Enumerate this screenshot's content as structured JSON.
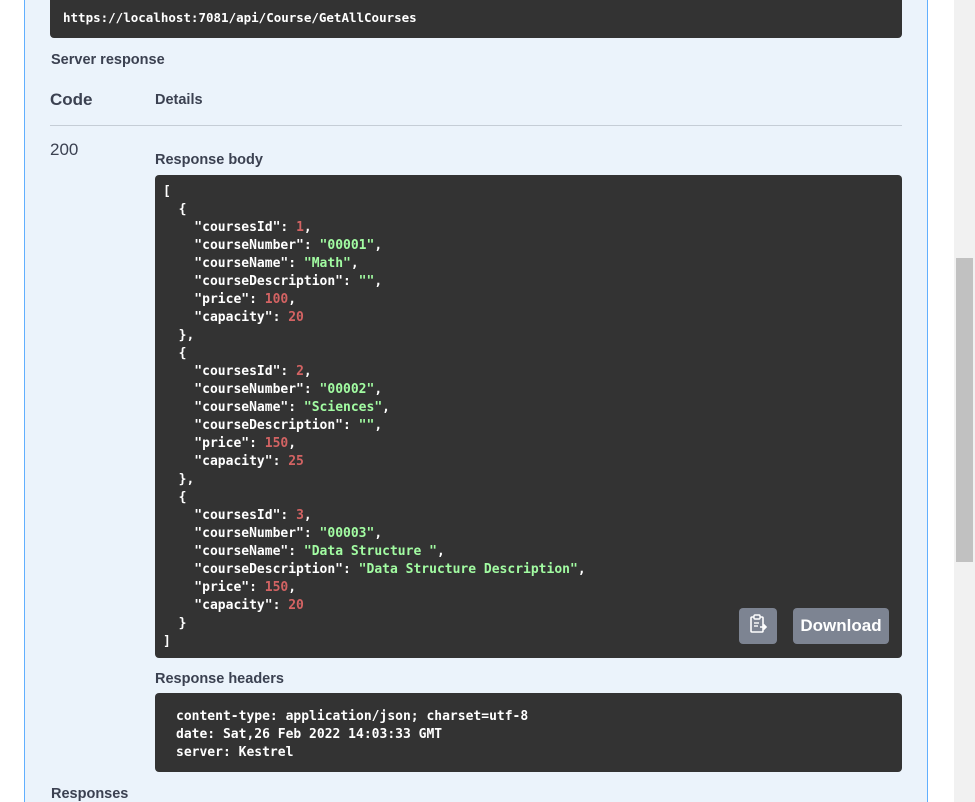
{
  "request_url": "https://localhost:7081/api/Course/GetAllCourses",
  "server_response_label": "Server response",
  "table": {
    "code_header": "Code",
    "details_header": "Details",
    "code_value": "200"
  },
  "response_body": {
    "label": "Response body",
    "lines": [
      [
        {
          "t": "[",
          "c": "p"
        }
      ],
      [
        {
          "t": "  {",
          "c": "p"
        }
      ],
      [
        {
          "t": "    \"coursesId\"",
          "c": "k"
        },
        {
          "t": ": ",
          "c": "p"
        },
        {
          "t": "1",
          "c": "n"
        },
        {
          "t": ",",
          "c": "p"
        }
      ],
      [
        {
          "t": "    \"courseNumber\"",
          "c": "k"
        },
        {
          "t": ": ",
          "c": "p"
        },
        {
          "t": "\"00001\"",
          "c": "s"
        },
        {
          "t": ",",
          "c": "p"
        }
      ],
      [
        {
          "t": "    \"courseName\"",
          "c": "k"
        },
        {
          "t": ": ",
          "c": "p"
        },
        {
          "t": "\"Math\"",
          "c": "s"
        },
        {
          "t": ",",
          "c": "p"
        }
      ],
      [
        {
          "t": "    \"courseDescription\"",
          "c": "k"
        },
        {
          "t": ": ",
          "c": "p"
        },
        {
          "t": "\"\"",
          "c": "s"
        },
        {
          "t": ",",
          "c": "p"
        }
      ],
      [
        {
          "t": "    \"price\"",
          "c": "k"
        },
        {
          "t": ": ",
          "c": "p"
        },
        {
          "t": "100",
          "c": "n"
        },
        {
          "t": ",",
          "c": "p"
        }
      ],
      [
        {
          "t": "    \"capacity\"",
          "c": "k"
        },
        {
          "t": ": ",
          "c": "p"
        },
        {
          "t": "20",
          "c": "n"
        }
      ],
      [
        {
          "t": "  },",
          "c": "p"
        }
      ],
      [
        {
          "t": "  {",
          "c": "p"
        }
      ],
      [
        {
          "t": "    \"coursesId\"",
          "c": "k"
        },
        {
          "t": ": ",
          "c": "p"
        },
        {
          "t": "2",
          "c": "n"
        },
        {
          "t": ",",
          "c": "p"
        }
      ],
      [
        {
          "t": "    \"courseNumber\"",
          "c": "k"
        },
        {
          "t": ": ",
          "c": "p"
        },
        {
          "t": "\"00002\"",
          "c": "s"
        },
        {
          "t": ",",
          "c": "p"
        }
      ],
      [
        {
          "t": "    \"courseName\"",
          "c": "k"
        },
        {
          "t": ": ",
          "c": "p"
        },
        {
          "t": "\"Sciences\"",
          "c": "s"
        },
        {
          "t": ",",
          "c": "p"
        }
      ],
      [
        {
          "t": "    \"courseDescription\"",
          "c": "k"
        },
        {
          "t": ": ",
          "c": "p"
        },
        {
          "t": "\"\"",
          "c": "s"
        },
        {
          "t": ",",
          "c": "p"
        }
      ],
      [
        {
          "t": "    \"price\"",
          "c": "k"
        },
        {
          "t": ": ",
          "c": "p"
        },
        {
          "t": "150",
          "c": "n"
        },
        {
          "t": ",",
          "c": "p"
        }
      ],
      [
        {
          "t": "    \"capacity\"",
          "c": "k"
        },
        {
          "t": ": ",
          "c": "p"
        },
        {
          "t": "25",
          "c": "n"
        }
      ],
      [
        {
          "t": "  },",
          "c": "p"
        }
      ],
      [
        {
          "t": "  {",
          "c": "p"
        }
      ],
      [
        {
          "t": "    \"coursesId\"",
          "c": "k"
        },
        {
          "t": ": ",
          "c": "p"
        },
        {
          "t": "3",
          "c": "n"
        },
        {
          "t": ",",
          "c": "p"
        }
      ],
      [
        {
          "t": "    \"courseNumber\"",
          "c": "k"
        },
        {
          "t": ": ",
          "c": "p"
        },
        {
          "t": "\"00003\"",
          "c": "s"
        },
        {
          "t": ",",
          "c": "p"
        }
      ],
      [
        {
          "t": "    \"courseName\"",
          "c": "k"
        },
        {
          "t": ": ",
          "c": "p"
        },
        {
          "t": "\"Data Structure \"",
          "c": "s"
        },
        {
          "t": ",",
          "c": "p"
        }
      ],
      [
        {
          "t": "    \"courseDescription\"",
          "c": "k"
        },
        {
          "t": ": ",
          "c": "p"
        },
        {
          "t": "\"Data Structure Description\"",
          "c": "s"
        },
        {
          "t": ",",
          "c": "p"
        }
      ],
      [
        {
          "t": "    \"price\"",
          "c": "k"
        },
        {
          "t": ": ",
          "c": "p"
        },
        {
          "t": "150",
          "c": "n"
        },
        {
          "t": ",",
          "c": "p"
        }
      ],
      [
        {
          "t": "    \"capacity\"",
          "c": "k"
        },
        {
          "t": ": ",
          "c": "p"
        },
        {
          "t": "20",
          "c": "n"
        }
      ],
      [
        {
          "t": "  }",
          "c": "p"
        }
      ],
      [
        {
          "t": "]",
          "c": "p"
        }
      ]
    ],
    "copy_icon": "clipboard-icon",
    "download_label": "Download"
  },
  "response_headers": {
    "label": "Response headers",
    "lines": [
      "content-type: application/json; charset=utf-8",
      "date: Sat,26 Feb 2022 14:03:33 GMT",
      "server: Kestrel"
    ]
  },
  "responses_label": "Responses",
  "colors": {
    "panel_bg": "#ebf3fb",
    "panel_border": "#61affe",
    "code_bg": "#333333",
    "json_string": "#a2fca2",
    "json_number": "#d36363",
    "button_bg": "#7d8492"
  }
}
